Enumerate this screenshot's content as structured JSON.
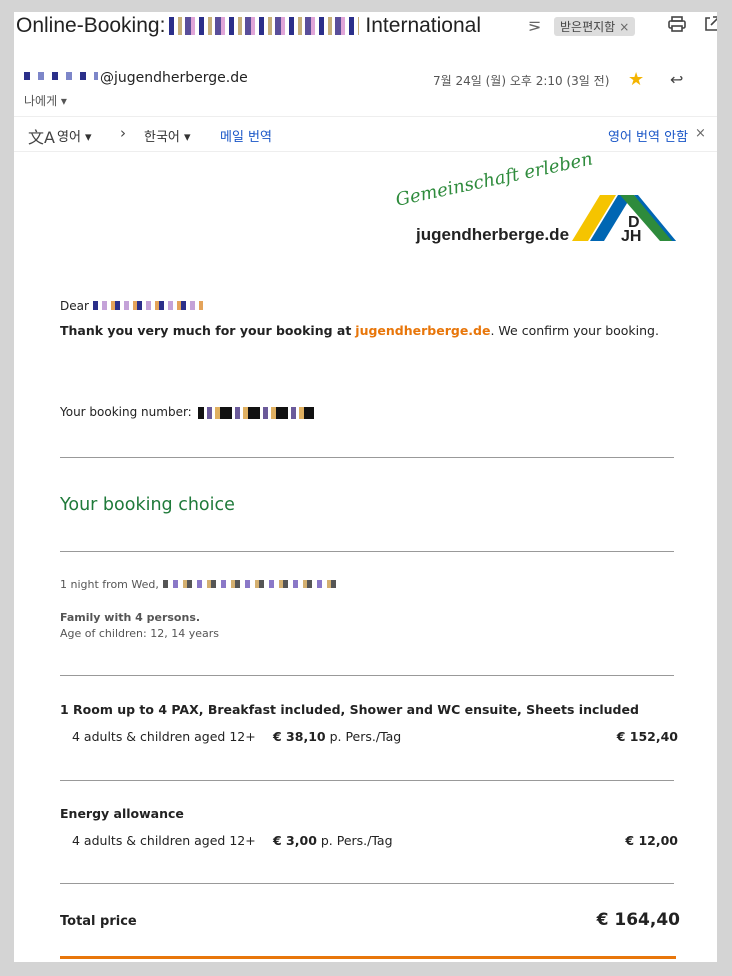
{
  "subject": {
    "prefix": "Online-Booking:",
    "suffix": "International",
    "label_chip": "받은편지함",
    "label_chip_close": "×"
  },
  "icons": {
    "label": "label-arrow-icon",
    "print": "print-icon",
    "open": "open-in-new-icon"
  },
  "sender": {
    "address": "@jugendherberge.de",
    "to": "나에게 ▾",
    "date": "7월 24일 (월) 오후 2:10 (3일 전)"
  },
  "translate_bar": {
    "source_lang": "영어 ▾",
    "arrow": "›",
    "target_lang": "한국어 ▾",
    "translate_mail": "메일 번역",
    "dont_translate": "영어 번역 안함",
    "close": "×"
  },
  "logo": {
    "script": "Gemeinschaft erleben",
    "text": "jugendherberge.de",
    "mark_letters": "DJH",
    "colors": {
      "yellow": "#f5c400",
      "blue": "#0066b3",
      "green": "#2e8b3c"
    }
  },
  "email": {
    "dear": "Dear",
    "thanks_bold": "Thank you very much for your booking at",
    "thanks_link": "jugendherberge.de",
    "thanks_rest": ". We confirm your booking.",
    "booking_number_label": "Your booking number:",
    "booking_choice_heading": "Your booking choice",
    "night_from": "1 night from Wed,",
    "family": "Family with 4 persons.",
    "ages": "Age of children: 12, 14 years",
    "room_title": "1 Room up to 4 PAX, Breakfast included, Shower and WC ensuite, Sheets included",
    "room_line": {
      "desc": "4 adults & children aged 12+",
      "price_bold": "€ 38,10",
      "price_unit": " p. Pers./Tag",
      "sum": "€ 152,40"
    },
    "energy_title": "Energy allowance",
    "energy_line": {
      "desc": "4 adults & children aged 12+",
      "price_bold": "€ 3,00",
      "price_unit": " p. Pers./Tag",
      "sum": "€ 12,00"
    },
    "total_label": "Total price",
    "total_value": "€ 164,40"
  },
  "colors": {
    "accent_link": "#e8760a",
    "heading_green": "#1f7a3a",
    "gmail_link": "#1a56c7",
    "star": "#f4b400"
  }
}
